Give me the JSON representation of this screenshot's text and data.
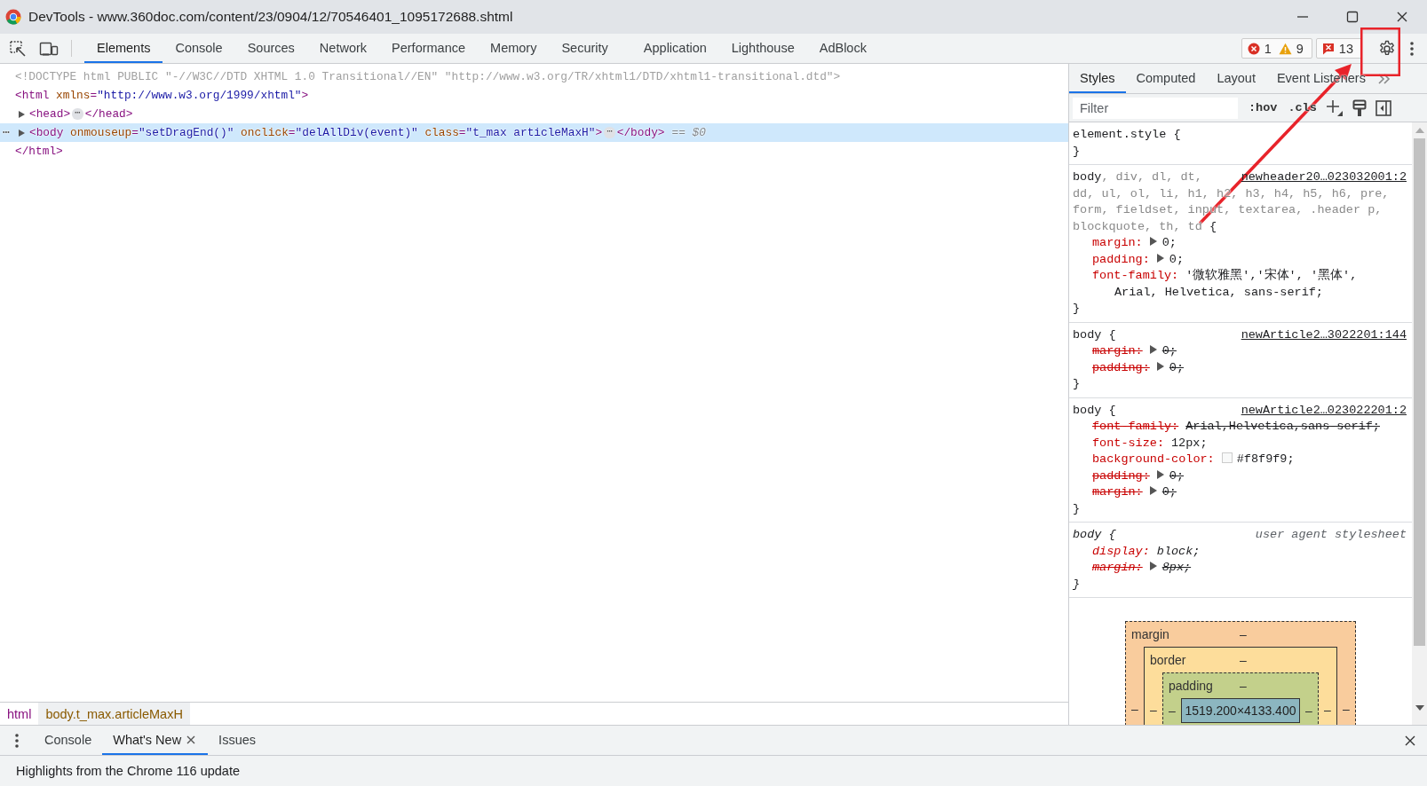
{
  "window": {
    "title": "DevTools - www.360doc.com/content/23/0904/12/70546401_1095172688.shtml"
  },
  "main_tabs": [
    {
      "label": "Elements",
      "selected": true
    },
    {
      "label": "Console",
      "selected": false
    },
    {
      "label": "Sources",
      "selected": false
    },
    {
      "label": "Network",
      "selected": false
    },
    {
      "label": "Performance",
      "selected": false
    },
    {
      "label": "Memory",
      "selected": false
    },
    {
      "label": "Security",
      "selected": false
    },
    {
      "label": "Application",
      "selected": false
    },
    {
      "label": "Lighthouse",
      "selected": false
    },
    {
      "label": "AdBlock",
      "selected": false
    }
  ],
  "status_counts": {
    "errors": "1",
    "warnings": "9",
    "issues": "13"
  },
  "dom_tree": [
    {
      "open": [
        {
          "kind": "doctype",
          "text": "<!DOCTYPE html PUBLIC \"-//W3C//DTD XHTML 1.0 Transitional//EN\" \"http://www.w3.org/TR/xhtml1/DTD/xhtml1-transitional.dtd\">"
        }
      ]
    },
    {
      "open": [
        {
          "kind": "tag",
          "text": "<html"
        },
        {
          "kind": "attr",
          "text": " xmlns"
        },
        {
          "kind": "plain",
          "text": "="
        },
        {
          "kind": "value",
          "text": "\"http://www.w3.org/1999/xhtml\""
        },
        {
          "kind": "tag",
          "text": ">"
        }
      ],
      "end_line": [
        {
          "kind": "tag",
          "text": "</html>"
        }
      ],
      "children": [
        {
          "open": [
            {
              "kind": "tag",
              "text": "<head>"
            }
          ],
          "expanded": false,
          "badge": "⋯",
          "close": [
            {
              "kind": "tag",
              "text": "</head>"
            }
          ]
        },
        {
          "open": [
            {
              "kind": "tag",
              "text": "<body"
            },
            {
              "kind": "attr",
              "text": " onmouseup"
            },
            {
              "kind": "plain",
              "text": "="
            },
            {
              "kind": "value",
              "text": "\"setDragEnd()\""
            },
            {
              "kind": "attr",
              "text": " onclick"
            },
            {
              "kind": "plain",
              "text": "="
            },
            {
              "kind": "value",
              "text": "\"delAllDiv(event)\""
            },
            {
              "kind": "attr",
              "text": " class"
            },
            {
              "kind": "plain",
              "text": "="
            },
            {
              "kind": "value",
              "text": "\"t_max articleMaxH\""
            },
            {
              "kind": "tag",
              "text": ">"
            }
          ],
          "expanded": false,
          "selected": true,
          "menu": "⋯",
          "badge": "⋯",
          "close": [
            {
              "kind": "tag",
              "text": "</body>"
            }
          ],
          "suffix": "== $0"
        }
      ]
    }
  ],
  "breadcrumbs": [
    {
      "label": "html",
      "selected": false
    },
    {
      "label": "body.t_max.articleMaxH",
      "selected": true
    }
  ],
  "sidebar_tabs": [
    {
      "label": "Styles",
      "selected": true
    },
    {
      "label": "Computed",
      "selected": false
    },
    {
      "label": "Layout",
      "selected": false
    },
    {
      "label": "Event Listeners",
      "selected": false
    }
  ],
  "styles_toolbar": {
    "filter_placeholder": "Filter",
    "hov": ":hov",
    "cls": ".cls"
  },
  "rules": [
    {
      "selector": [
        [
          {
            "text": "element.style {",
            "matched": true
          }
        ]
      ],
      "close": "}"
    },
    {
      "selector": [
        [
          {
            "text": "body",
            "matched": true
          },
          {
            "text": ", div, dl, dt,",
            "matched": false
          }
        ],
        [
          {
            "text": "dd, ul, ol, li, h1, h2, h3, h4, h5, h6, pre,",
            "matched": false
          }
        ],
        [
          {
            "text": "form, fieldset, input, textarea, .header p,",
            "matched": false
          }
        ],
        [
          {
            "text": "blockquote, th, td",
            "matched": false
          },
          {
            "text": " {",
            "matched": true
          }
        ]
      ],
      "source": "newheader20…023032001:2",
      "declarations": [
        {
          "property": "margin:",
          "value": [
            "0;"
          ],
          "expandable": true,
          "overridden": false
        },
        {
          "property": "padding:",
          "value": [
            "0;"
          ],
          "expandable": true,
          "overridden": false
        },
        {
          "property": "font-family:",
          "value": [
            "'微软雅黑','宋体', '黑体',",
            "Arial, Helvetica, sans-serif;"
          ],
          "overridden": false
        }
      ],
      "close": "}"
    },
    {
      "selector": [
        [
          {
            "text": "body {",
            "matched": true
          }
        ]
      ],
      "source": "newArticle2…3022201:144",
      "declarations": [
        {
          "property": "margin:",
          "value": [
            "0;"
          ],
          "expandable": true,
          "overridden": true
        },
        {
          "property": "padding:",
          "value": [
            "0;"
          ],
          "expandable": true,
          "overridden": true
        }
      ],
      "close": "}"
    },
    {
      "selector": [
        [
          {
            "text": "body {",
            "matched": true
          }
        ]
      ],
      "source": "newArticle2…023022201:2",
      "declarations": [
        {
          "property": "font-family:",
          "value": [
            "Arial,Helvetica,sans-serif;"
          ],
          "overridden": true
        },
        {
          "property": "font-size:",
          "value": [
            "12px;"
          ],
          "overridden": false
        },
        {
          "property": "background-color:",
          "value": [
            "#f8f9f9;"
          ],
          "color": "#f8f9f9",
          "overridden": false
        },
        {
          "property": "padding:",
          "value": [
            "0;"
          ],
          "expandable": true,
          "overridden": true
        },
        {
          "property": "margin:",
          "value": [
            "0;"
          ],
          "expandable": true,
          "overridden": true
        }
      ],
      "close": "}"
    },
    {
      "selector": [
        [
          {
            "text": "body {",
            "matched": true
          }
        ]
      ],
      "source": "user agent stylesheet",
      "user_agent": true,
      "declarations": [
        {
          "property": "display:",
          "value": [
            "block;"
          ],
          "overridden": false
        },
        {
          "property": "margin:",
          "value": [
            "8px;"
          ],
          "expandable": true,
          "overridden": true
        }
      ],
      "close": "}"
    }
  ],
  "box_model": {
    "layers": [
      {
        "label": "margin",
        "top": "–",
        "left": "–",
        "right": "–"
      },
      {
        "label": "border",
        "top": "–",
        "left": "–",
        "right": "–"
      },
      {
        "label": "padding",
        "top": "–",
        "left": "–",
        "right": "–"
      }
    ],
    "content": "1519.200×4133.400"
  },
  "drawer": {
    "tabs": [
      {
        "label": "Console",
        "selected": false
      },
      {
        "label": "What's New",
        "selected": true,
        "closable": true
      },
      {
        "label": "Issues",
        "selected": false
      }
    ],
    "message": "Highlights from the Chrome 116 update"
  },
  "annotations": [
    {
      "kind": "box"
    },
    {
      "kind": "arrow"
    }
  ]
}
